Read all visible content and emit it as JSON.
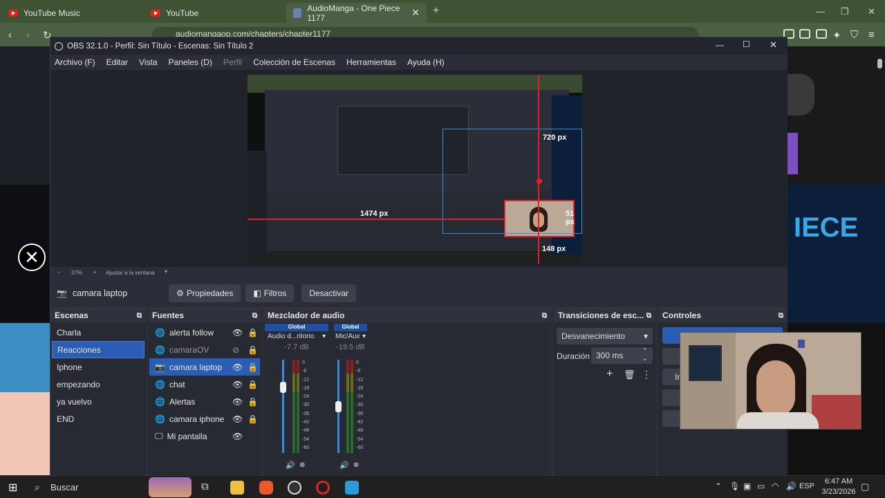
{
  "browser": {
    "tabs": [
      {
        "label": "YouTube Music"
      },
      {
        "label": "YouTube"
      },
      {
        "label": "AudioManga - One Piece 1177",
        "active": true
      }
    ],
    "url": "audiomangaop.com/chapters/chapter1177",
    "add_tab": "+"
  },
  "obs": {
    "title": "OBS 32.1.0 - Perfil: Sin Título - Escenas: Sin Título 2",
    "menu": [
      "Archivo (F)",
      "Editar",
      "Vista",
      "Paneles (D)",
      "Perfil",
      "Colección de Escenas",
      "Herramientas",
      "Ayuda (H)"
    ],
    "preview": {
      "labels": {
        "top": "720 px",
        "left": "1474 px",
        "right": "51 px",
        "bottom": "148 px"
      },
      "zoom": "37%",
      "fit": "Ajustar a la ventana"
    },
    "source_toolbar": {
      "selected_source": "camara laptop",
      "properties": "Propiedades",
      "filters": "Filtros",
      "deactivate": "Desactivar"
    },
    "scenes": {
      "title": "Escenas",
      "items": [
        "Charla",
        "Reacciones",
        "Iphone",
        "empezando",
        "ya vuelvo",
        "END"
      ],
      "selected": "Reacciones"
    },
    "sources": {
      "title": "Fuentes",
      "items": [
        {
          "label": "alerta follow",
          "icon": "globe-icon"
        },
        {
          "label": "camaraOV",
          "icon": "globe-icon",
          "hidden": true
        },
        {
          "label": "camara laptop",
          "icon": "camera-icon",
          "selected": true
        },
        {
          "label": "chat",
          "icon": "globe-icon"
        },
        {
          "label": "Alertas",
          "icon": "globe-icon"
        },
        {
          "label": "camara iphone",
          "icon": "globe-icon"
        },
        {
          "label": "Mi pantalla",
          "icon": "monitor-icon"
        }
      ]
    },
    "mixer": {
      "title": "Mezclador de audio",
      "channels": [
        {
          "tag": "Global",
          "name": "Audio d...ritorio",
          "db": "-7.7 dB",
          "fader": 0.8
        },
        {
          "tag": "Global",
          "name": "Mic/Aux",
          "db": "-19.5 dB",
          "fader": 0.62
        }
      ],
      "scale": [
        "0",
        "-6",
        "-12",
        "-18",
        "-24",
        "-30",
        "-36",
        "-42",
        "-48",
        "-54",
        "-60"
      ]
    },
    "transitions": {
      "title": "Transiciones de esc...",
      "type": "Desvanecimiento",
      "duration_label": "Duración",
      "duration_value": "300 ms"
    },
    "controls": {
      "title": "Controles",
      "partial_labels": [
        "In"
      ]
    }
  },
  "taskbar": {
    "search": "Buscar",
    "language": "ESP",
    "time": "6:47 AM",
    "date": "3/23/2026"
  },
  "colors": {
    "browser_frame": "#3f5234",
    "obs_bg": "#2b2e38",
    "selection": "#2a5db3",
    "guide_red": "#e0202a",
    "bbox_blue": "#3a8be0"
  }
}
